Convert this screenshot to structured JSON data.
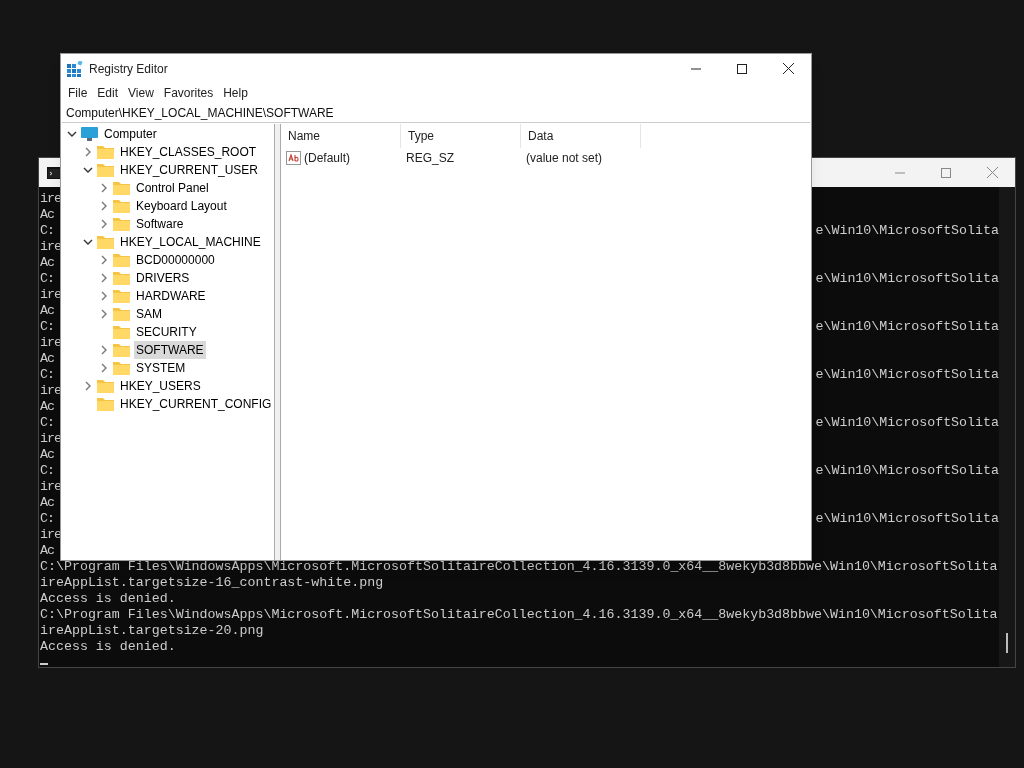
{
  "terminal": {
    "lines": [
      {
        "kind": "split",
        "left": "ire"
      },
      {
        "kind": "split",
        "left": "Ac"
      },
      {
        "kind": "split",
        "left": "C:",
        "right": "e\\Win10\\MicrosoftSolita"
      },
      {
        "kind": "split",
        "left": "ire"
      },
      {
        "kind": "split",
        "left": "Ac"
      },
      {
        "kind": "split",
        "left": "C:",
        "right": "e\\Win10\\MicrosoftSolita"
      },
      {
        "kind": "split",
        "left": "ire"
      },
      {
        "kind": "split",
        "left": "Ac"
      },
      {
        "kind": "split",
        "left": "C:",
        "right": "e\\Win10\\MicrosoftSolita"
      },
      {
        "kind": "split",
        "left": "ire"
      },
      {
        "kind": "split",
        "left": "Ac"
      },
      {
        "kind": "split",
        "left": "C:",
        "right": "e\\Win10\\MicrosoftSolita"
      },
      {
        "kind": "split",
        "left": "ire"
      },
      {
        "kind": "split",
        "left": "Ac"
      },
      {
        "kind": "split",
        "left": "C:",
        "right": "e\\Win10\\MicrosoftSolita"
      },
      {
        "kind": "split",
        "left": "ire"
      },
      {
        "kind": "split",
        "left": "Ac"
      },
      {
        "kind": "split",
        "left": "C:",
        "right": "e\\Win10\\MicrosoftSolita"
      },
      {
        "kind": "split",
        "left": "ire"
      },
      {
        "kind": "split",
        "left": "Ac"
      },
      {
        "kind": "split",
        "left": "C:",
        "right": "e\\Win10\\MicrosoftSolita"
      },
      {
        "kind": "split",
        "left": "ire"
      },
      {
        "kind": "split",
        "left": "Ac"
      },
      {
        "kind": "full",
        "text": "C:\\Program Files\\WindowsApps\\Microsoft.MicrosoftSolitaireCollection_4.16.3139.0_x64__8wekyb3d8bbwe\\Win10\\MicrosoftSolita"
      },
      {
        "kind": "full",
        "text": "ireAppList.targetsize-16_contrast-white.png"
      },
      {
        "kind": "full",
        "text": "Access is denied."
      },
      {
        "kind": "full",
        "text": "C:\\Program Files\\WindowsApps\\Microsoft.MicrosoftSolitaireCollection_4.16.3139.0_x64__8wekyb3d8bbwe\\Win10\\MicrosoftSolita"
      },
      {
        "kind": "full",
        "text": "ireAppList.targetsize-20.png"
      },
      {
        "kind": "full",
        "text": "Access is denied."
      }
    ]
  },
  "registry": {
    "window": {
      "title": "Registry Editor"
    },
    "menu": [
      "File",
      "Edit",
      "View",
      "Favorites",
      "Help"
    ],
    "address": "Computer\\HKEY_LOCAL_MACHINE\\SOFTWARE",
    "tree": [
      {
        "label": "Computer",
        "kind": "computer",
        "expandable": true,
        "selected": false,
        "children": [
          {
            "label": "HKEY_CLASSES_ROOT",
            "kind": "folder",
            "expandable": true,
            "selected": false
          },
          {
            "label": "HKEY_CURRENT_USER",
            "kind": "folder",
            "expandable": true,
            "selected": false,
            "children": [
              {
                "label": "Control Panel",
                "kind": "folder",
                "expandable": true,
                "selected": false
              },
              {
                "label": "Keyboard Layout",
                "kind": "folder",
                "expandable": true,
                "selected": false
              },
              {
                "label": "Software",
                "kind": "folder",
                "expandable": true,
                "selected": false
              }
            ]
          },
          {
            "label": "HKEY_LOCAL_MACHINE",
            "kind": "folder",
            "expandable": true,
            "selected": false,
            "children": [
              {
                "label": "BCD00000000",
                "kind": "folder",
                "expandable": true,
                "selected": false
              },
              {
                "label": "DRIVERS",
                "kind": "folder",
                "expandable": true,
                "selected": false
              },
              {
                "label": "HARDWARE",
                "kind": "folder",
                "expandable": true,
                "selected": false
              },
              {
                "label": "SAM",
                "kind": "folder",
                "expandable": true,
                "selected": false
              },
              {
                "label": "SECURITY",
                "kind": "folder",
                "expandable": false,
                "selected": false
              },
              {
                "label": "SOFTWARE",
                "kind": "folder",
                "expandable": true,
                "selected": true
              },
              {
                "label": "SYSTEM",
                "kind": "folder",
                "expandable": true,
                "selected": false
              }
            ]
          },
          {
            "label": "HKEY_USERS",
            "kind": "folder",
            "expandable": true,
            "selected": false
          },
          {
            "label": "HKEY_CURRENT_CONFIG",
            "kind": "folder",
            "expandable": false,
            "selected": false
          }
        ]
      }
    ],
    "columns": [
      "Name",
      "Type",
      "Data"
    ],
    "rows": [
      [
        "(Default)",
        "REG_SZ",
        "(value not set)"
      ]
    ]
  }
}
